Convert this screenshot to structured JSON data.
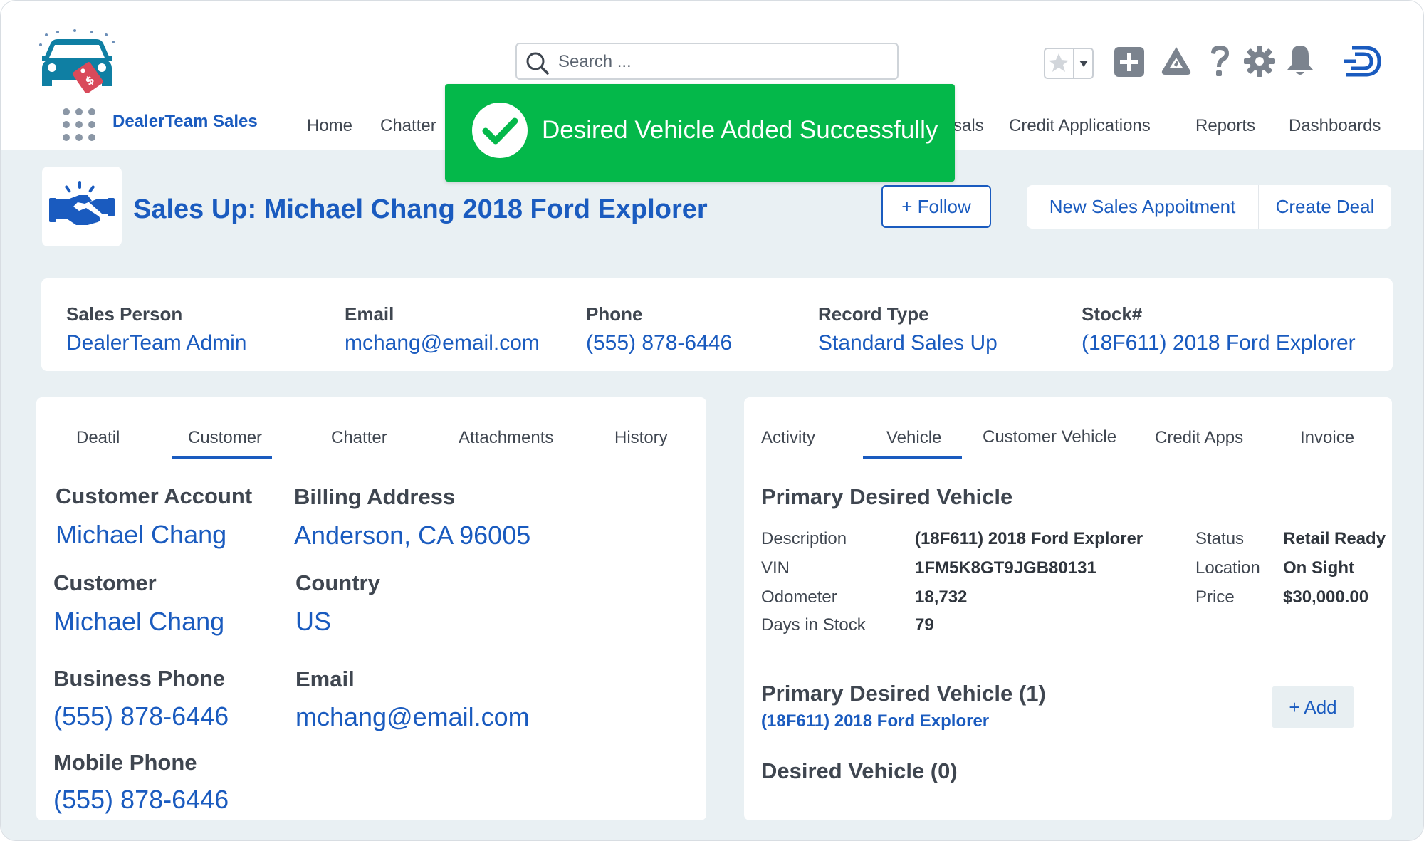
{
  "app": {
    "name": "DealerTeam Sales"
  },
  "search": {
    "placeholder": "Search ..."
  },
  "nav": {
    "items": [
      "Home",
      "Chatter",
      "Proposals",
      "Credit Applications",
      "Reports",
      "Dashboards"
    ],
    "visible_partial": "sals"
  },
  "toast": {
    "message": "Desired Vehicle Added Successfully",
    "color": "#04b84a"
  },
  "record": {
    "title": "Sales Up: Michael Chang 2018 Ford Explorer",
    "follow_label": "+ Follow",
    "actions": [
      "New Sales Appoitment",
      "Create Deal"
    ]
  },
  "highlights": {
    "sales_person": {
      "label": "Sales Person",
      "value": "DealerTeam Admin"
    },
    "email": {
      "label": "Email",
      "value": "mchang@email.com"
    },
    "phone": {
      "label": "Phone",
      "value": "(555) 878-6446"
    },
    "record_type": {
      "label": "Record Type",
      "value": "Standard Sales Up"
    },
    "stock": {
      "label": "Stock#",
      "value": "(18F611) 2018 Ford Explorer"
    }
  },
  "left_panel": {
    "tabs": [
      "Deatil",
      "Customer",
      "Chatter",
      "Attachments",
      "History"
    ],
    "active_tab": "Customer",
    "fields": {
      "customer_account": {
        "label": "Customer Account",
        "value": "Michael Chang"
      },
      "billing_address": {
        "label": "Billing Address",
        "value": "Anderson, CA 96005"
      },
      "customer": {
        "label": "Customer",
        "value": "Michael Chang"
      },
      "country": {
        "label": "Country",
        "value": "US"
      },
      "business_phone": {
        "label": "Business Phone",
        "value": "(555) 878-6446"
      },
      "email": {
        "label": "Email",
        "value": "mchang@email.com"
      },
      "mobile_phone": {
        "label": "Mobile Phone",
        "value": "(555) 878-6446"
      }
    }
  },
  "right_panel": {
    "tabs": [
      "Activity",
      "Vehicle",
      "Customer Vehicle",
      "Credit Apps",
      "Invoice"
    ],
    "active_tab": "Vehicle",
    "section_title": "Primary Desired Vehicle",
    "details_left": [
      {
        "key": "Description",
        "value": "(18F611) 2018 Ford Explorer"
      },
      {
        "key": "VIN",
        "value": "1FM5K8GT9JGB80131"
      },
      {
        "key": "Odometer",
        "value": "18,732"
      },
      {
        "key": "Days in Stock",
        "value": "79"
      }
    ],
    "details_right": [
      {
        "key": "Status",
        "value": "Retail Ready"
      },
      {
        "key": "Location",
        "value": "On Sight"
      },
      {
        "key": "Price",
        "value": "$30,000.00"
      }
    ],
    "primary_list_title": "Primary Desired Vehicle (1)",
    "primary_list_item": "(18F611) 2018 Ford Explorer",
    "add_label": "+ Add",
    "desired_list_title": "Desired Vehicle (0)"
  },
  "colors": {
    "accent": "#1a5bbf",
    "background": "#e9f0f3",
    "logo": "#0f7fa3"
  }
}
